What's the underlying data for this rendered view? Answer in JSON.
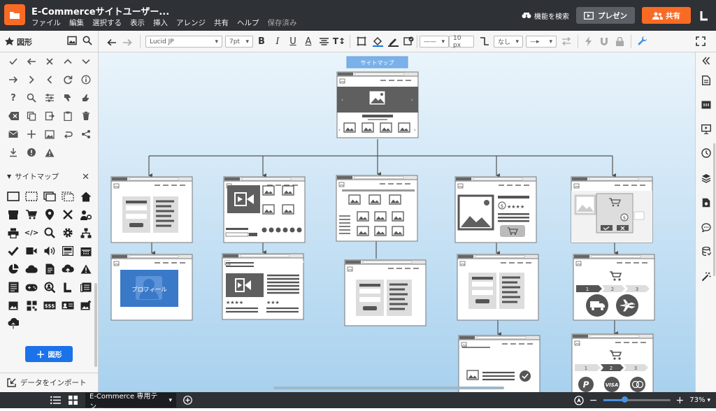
{
  "app": {
    "doc_title": "E-Commerceサイトユーザー...",
    "menu": [
      "ファイル",
      "編集",
      "選択する",
      "表示",
      "挿入",
      "アレンジ",
      "共有",
      "ヘルプ"
    ],
    "save_status": "保存済み",
    "feature_search": "機能を検索",
    "present_label": "プレゼン",
    "share_label": "共有"
  },
  "toolbar": {
    "panel_title": "図形",
    "font_name": "Lucid JP",
    "font_size": "7pt",
    "line_width": "10 px",
    "arrow_start": "なし"
  },
  "library": {
    "name": "サイトマップ",
    "add_shape_label": "図形",
    "import_label": "データをインポート"
  },
  "canvas": {
    "badge": "サイトマップ",
    "profile_label": "プロフィール",
    "steps": [
      "1",
      "2",
      "3"
    ],
    "card_visa": "VISA",
    "card_sss": "$$$"
  },
  "bottom": {
    "page_tab": "E-Commerce 専用テン...",
    "zoom": "73%",
    "zoom_fraction": 0.32
  },
  "colors": {
    "accent_orange": "#f96b24",
    "selection_blue": "#1a73e8",
    "wire_dark": "#5f5f5f",
    "wire_light": "#dddddd"
  }
}
